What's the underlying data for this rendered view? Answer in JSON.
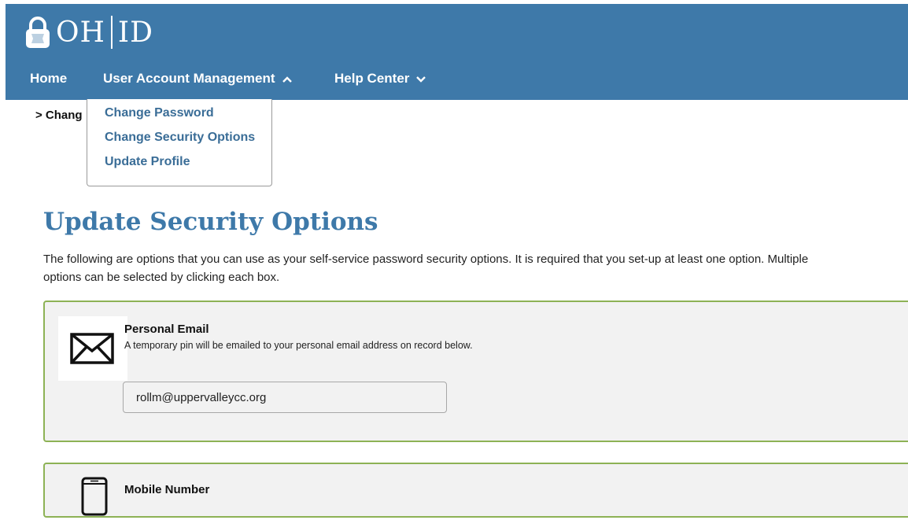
{
  "header": {
    "logo_left": "OH",
    "logo_right": "ID"
  },
  "nav": {
    "home": "Home",
    "user_account_management": "User Account Management",
    "help_center": "Help Center"
  },
  "breadcrumb": "> Chang",
  "dropdown": {
    "items": [
      "Change Password",
      "Change Security Options",
      "Update Profile"
    ]
  },
  "main": {
    "title": "Update Security Options",
    "intro_line1": "The following are options that you can use as your self-service password security options. It is required that you set-up at least one option. Multiple",
    "intro_line2": "options can be selected by clicking each box."
  },
  "cards": {
    "email": {
      "title": "Personal Email",
      "description": "A temporary pin will be emailed to your personal email address on record below.",
      "value": "rollm@uppervalleycc.org"
    },
    "mobile": {
      "title": "Mobile Number"
    }
  },
  "colors": {
    "header_bg": "#3e79a9",
    "title": "#3e79a9",
    "link": "#3a6d97",
    "card_border": "#8db255",
    "card_bg": "#f2f2f2"
  },
  "icons": [
    "padlock-logo-icon",
    "chevron-up-icon",
    "chevron-down-icon",
    "envelope-icon",
    "mobile-phone-icon"
  ]
}
